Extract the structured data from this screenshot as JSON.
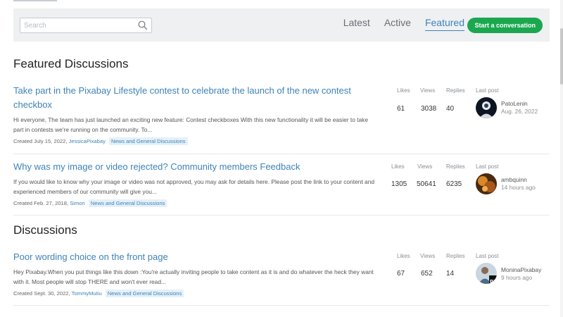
{
  "search": {
    "placeholder": "Search"
  },
  "tabs": [
    {
      "label": "Latest",
      "active": false
    },
    {
      "label": "Active",
      "active": false
    },
    {
      "label": "Featured",
      "active": true
    }
  ],
  "start_button": "Start a conversation",
  "featured": {
    "heading": "Featured Discussions",
    "threads": [
      {
        "title": "Take part in the Pixabay Lifestyle contest to celebrate the launch of the new contest checkbox",
        "excerpt": "Hi everyone, The team has just launched an exciting new feature: Contest checkboxes With this new functionality it will be easier to take part in contests we're running on the community. To...",
        "created": "Created July 15, 2022,",
        "user": "JessicaPixabay",
        "category": "News and General Discussions",
        "labels": {
          "likes": "Likes",
          "views": "Views",
          "replies": "Replies",
          "last": "Last post"
        },
        "likes": "61",
        "views": "3038",
        "replies": "40",
        "last_user": "PatoLenin",
        "last_time": "Aug. 26, 2022"
      },
      {
        "title": "Why was my image or video rejected? Community members Feedback",
        "excerpt": "If you would like to know why your image or video was not approved, you may ask for details here. Please post the link to your content and experienced members of our community will give you...",
        "created": "Created Feb. 27, 2018,",
        "user": "Simon",
        "category": "News and General Discussions",
        "labels": {
          "likes": "Likes",
          "views": "Views",
          "replies": "Replies",
          "last": "Last post"
        },
        "likes": "1305",
        "views": "50641",
        "replies": "6235",
        "last_user": "ambquinn",
        "last_time": "14 hours ago"
      }
    ]
  },
  "discussions": {
    "heading": "Discussions",
    "threads": [
      {
        "title": "Poor wording choice on the front page",
        "excerpt": "Hey Pixabay.When you put things like this down :You're actually inviting people to take content as it is and do whatever the heck they want with it. Most people will stop THERE and won't ever read...",
        "created": "Created Sept. 30, 2022,",
        "user": "TommyMutiu",
        "category": "News and General Discussions",
        "labels": {
          "likes": "Likes",
          "views": "Views",
          "replies": "Replies",
          "last": "Last post"
        },
        "likes": "67",
        "views": "652",
        "replies": "14",
        "last_user": "MoninaPixabay",
        "last_time": "9 hours ago"
      }
    ]
  },
  "colors": {
    "link": "#3d83b8",
    "accent_button": "#1ba74f",
    "toolbar_bg": "#eef0f2"
  }
}
